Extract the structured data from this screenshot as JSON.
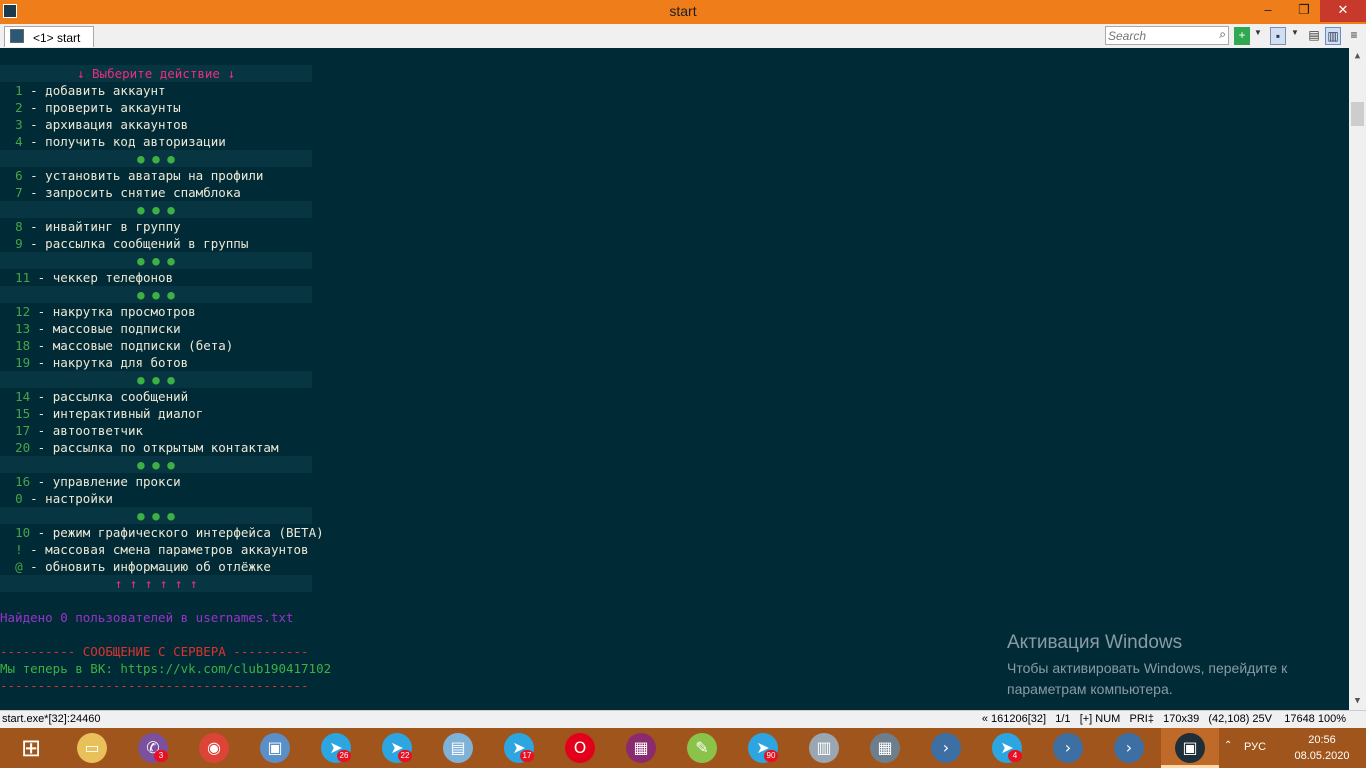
{
  "window": {
    "title": "start",
    "controls": {
      "minimize": "–",
      "maximize": "❐",
      "close": "✕"
    }
  },
  "tabbar": {
    "tab_label": "<1> start",
    "search_placeholder": "Search",
    "icons": [
      "plus-icon",
      "dropdown-arrow",
      "panel-icon",
      "dropdown-arrow",
      "layout-icon",
      "menu-icon"
    ]
  },
  "menu": {
    "header": "↓ Выберите действие ↓",
    "separator": "● ● ●",
    "footer": "↑ ↑ ↑ ↑ ↑ ↑",
    "groups": [
      [
        {
          "n": "1",
          "label": " - добавить аккаунт"
        },
        {
          "n": "2",
          "label": " - проверить аккаунты"
        },
        {
          "n": "3",
          "label": " - архивация аккаунтов"
        },
        {
          "n": "4",
          "label": " - получить код авторизации"
        }
      ],
      [
        {
          "n": "6",
          "label": " - установить аватары на профили"
        },
        {
          "n": "7",
          "label": " - запросить снятие спамблока"
        }
      ],
      [
        {
          "n": "8",
          "label": " - инвайтинг в группу"
        },
        {
          "n": "9",
          "label": " - рассылка сообщений в группы"
        }
      ],
      [
        {
          "n": "11",
          "label": " - чеккер телефонов"
        }
      ],
      [
        {
          "n": "12",
          "label": " - накрутка просмотров"
        },
        {
          "n": "13",
          "label": " - массовые подписки"
        },
        {
          "n": "18",
          "label": " - массовые подписки (бета)"
        },
        {
          "n": "19",
          "label": " - накрутка для ботов"
        }
      ],
      [
        {
          "n": "14",
          "label": " - рассылка сообщений"
        },
        {
          "n": "15",
          "label": " - интерактивный диалог"
        },
        {
          "n": "17",
          "label": " - автоответчик"
        },
        {
          "n": "20",
          "label": " - рассылка по открытым контактам"
        }
      ],
      [
        {
          "n": "16",
          "label": " - управление прокси"
        },
        {
          "n": "0",
          "label": " - настройки"
        }
      ],
      [
        {
          "n": "10",
          "label": " - режим графического интерфейса (BETA)"
        },
        {
          "n": "!",
          "label": " - массовая смена параметров аккаунтов"
        },
        {
          "n": "@",
          "label": " - обновить информацию об отлёжке"
        }
      ]
    ]
  },
  "output": {
    "found": "Найдено 0 пользователей в usernames.txt",
    "server_header": "---------- СООБЩЕНИЕ С СЕРВЕРА ----------",
    "server_msg": "Мы теперь в ВК: https://vk.com/club190417102",
    "server_footer": "-----------------------------------------"
  },
  "watermark": {
    "title": "Активация Windows",
    "line1": "Чтобы активировать Windows, перейдите к",
    "line2": "параметрам компьютера."
  },
  "status": {
    "left": "start.exe*[32]:24460",
    "right": "« 161206[32]   1/1   [+] NUM   PRI‡   170x39   (42,108) 25V    17648 100%"
  },
  "taskbar": {
    "apps": [
      {
        "name": "start-button",
        "glyph": "⊞",
        "color": "#a0551c",
        "badge": ""
      },
      {
        "name": "explorer-icon",
        "glyph": "▭",
        "color": "#e8c15a",
        "badge": ""
      },
      {
        "name": "viber-icon",
        "glyph": "✆",
        "color": "#7b519d",
        "badge": "3"
      },
      {
        "name": "chrome-icon",
        "glyph": "◉",
        "color": "#db4437",
        "badge": ""
      },
      {
        "name": "remote-desktop-icon",
        "glyph": "▣",
        "color": "#5a8fc7",
        "badge": ""
      },
      {
        "name": "telegram-icon",
        "glyph": "➤",
        "color": "#2ca5e0",
        "badge": "26"
      },
      {
        "name": "telegram-icon",
        "glyph": "➤",
        "color": "#2ca5e0",
        "badge": "22"
      },
      {
        "name": "notepad-icon",
        "glyph": "▤",
        "color": "#7fb2d9",
        "badge": ""
      },
      {
        "name": "telegram-icon",
        "glyph": "➤",
        "color": "#2ca5e0",
        "badge": "17"
      },
      {
        "name": "opera-icon",
        "glyph": "O",
        "color": "#e3001b",
        "badge": ""
      },
      {
        "name": "winrar-icon",
        "glyph": "▦",
        "color": "#8a2b6f",
        "badge": ""
      },
      {
        "name": "notepadpp-icon",
        "glyph": "✎",
        "color": "#8bc34a",
        "badge": ""
      },
      {
        "name": "telegram-icon",
        "glyph": "➤",
        "color": "#2ca5e0",
        "badge": "90"
      },
      {
        "name": "monitor-icon",
        "glyph": "▥",
        "color": "#9aa7b2",
        "badge": ""
      },
      {
        "name": "calculator-icon",
        "glyph": "▦",
        "color": "#6d7f8c",
        "badge": ""
      },
      {
        "name": "python-icon",
        "glyph": "›",
        "color": "#3d6fa3",
        "badge": ""
      },
      {
        "name": "telegram-icon",
        "glyph": "➤",
        "color": "#2ca5e0",
        "badge": "4"
      },
      {
        "name": "python-icon",
        "glyph": "›",
        "color": "#3d6fa3",
        "badge": ""
      },
      {
        "name": "python-icon",
        "glyph": "›",
        "color": "#3d6fa3",
        "badge": ""
      },
      {
        "name": "conemu-icon",
        "glyph": "▣",
        "color": "#1f2f3a",
        "badge": ""
      }
    ],
    "tray": {
      "lang": "РУС",
      "time": "20:56",
      "date": "08.05.2020"
    }
  }
}
